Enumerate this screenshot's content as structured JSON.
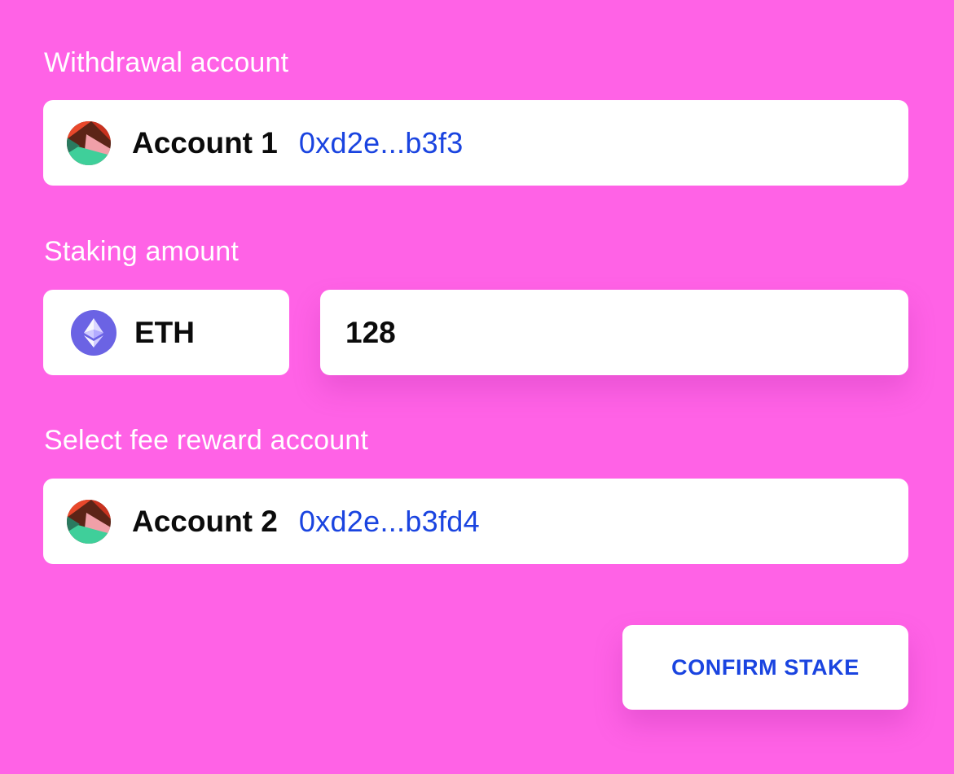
{
  "withdrawal": {
    "label": "Withdrawal account",
    "account_name": "Account 1",
    "account_address": "0xd2e...b3f3",
    "avatar_icon": "account-avatar-icon"
  },
  "staking": {
    "label": "Staking amount",
    "token": "ETH",
    "token_icon": "ethereum-icon",
    "amount": "128"
  },
  "fee_reward": {
    "label": "Select fee reward account",
    "account_name": "Account 2",
    "account_address": "0xd2e...b3fd4",
    "avatar_icon": "account-avatar-icon"
  },
  "actions": {
    "confirm_label": "CONFIRM STAKE"
  },
  "colors": {
    "background": "#ff62e6",
    "address_blue": "#1a44e0",
    "eth_purple": "#6b63e4"
  }
}
